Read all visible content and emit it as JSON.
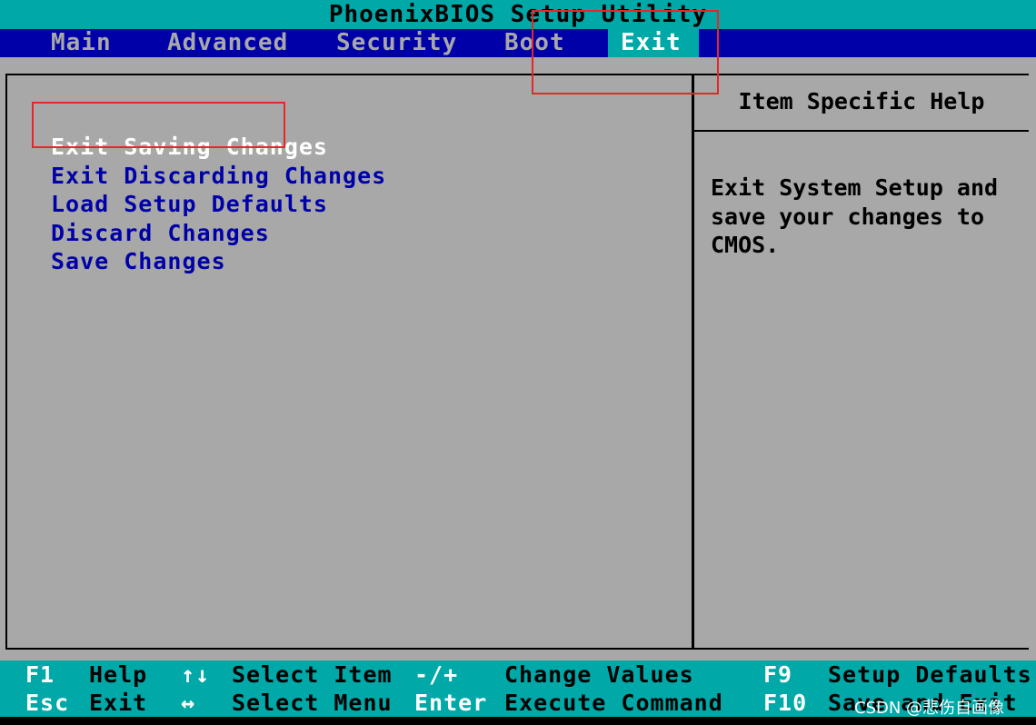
{
  "app_title": "PhoenixBIOS Setup Utility",
  "tabs": [
    {
      "label": "Main"
    },
    {
      "label": "Advanced"
    },
    {
      "label": "Security"
    },
    {
      "label": "Boot"
    },
    {
      "label": "Exit",
      "active": true
    }
  ],
  "menu": {
    "selected_index": 0,
    "items": [
      {
        "label": "Exit Saving Changes"
      },
      {
        "label": "Exit Discarding Changes"
      },
      {
        "label": "Load Setup Defaults"
      },
      {
        "label": "Discard Changes"
      },
      {
        "label": "Save Changes"
      }
    ]
  },
  "help": {
    "title": "Item Specific Help",
    "text": "Exit System Setup and\nsave your changes to\nCMOS."
  },
  "footer": {
    "row1": [
      {
        "key": "F1",
        "label": "Help"
      },
      {
        "key": "↑↓",
        "label": "Select Item"
      },
      {
        "key": "-/+",
        "label": "Change Values"
      },
      {
        "key": "F9",
        "label": "Setup Defaults"
      }
    ],
    "row2": [
      {
        "key": "Esc",
        "label": "Exit"
      },
      {
        "key": "↔",
        "label": "Select Menu"
      },
      {
        "key": "Enter",
        "label": "Execute Command"
      },
      {
        "key": "F10",
        "label": "Save and Exit"
      }
    ]
  },
  "watermark": "CSDN @悲伤自画像",
  "colors": {
    "title_bg": "#00a8a8",
    "menu_bar_bg": "#0000a8",
    "panel_bg": "#a8a8a8",
    "item_text": "#0000a8",
    "selected_text": "#ffffff",
    "annotation_red": "#e8262a"
  }
}
